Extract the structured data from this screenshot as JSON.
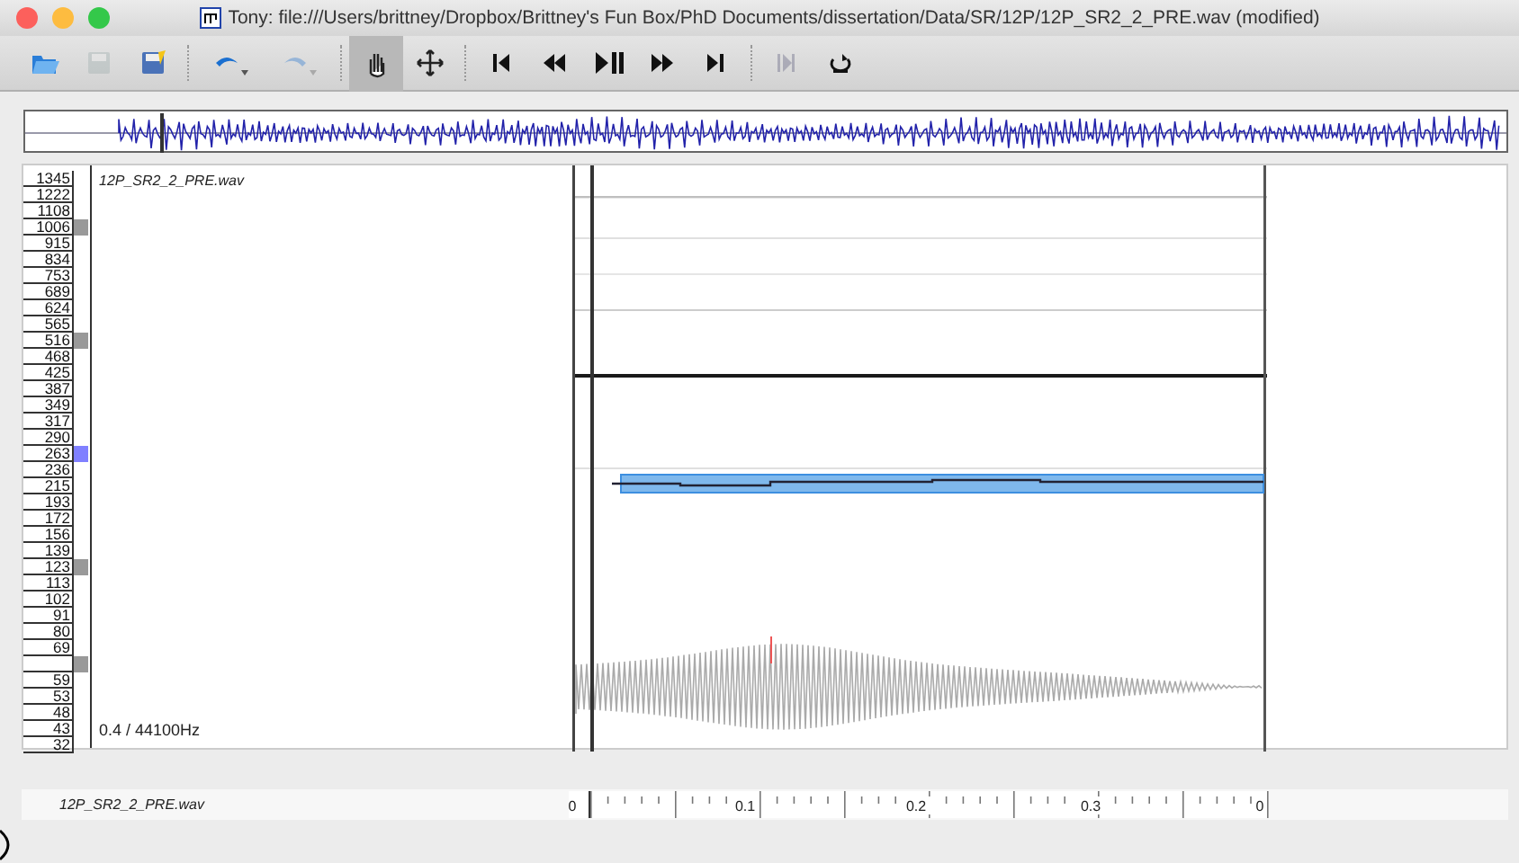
{
  "window": {
    "title": "Tony: file:///Users/brittney/Dropbox/Brittney's Fun Box/PhD Documents/dissertation/Data/SR/12P/12P_SR2_2_PRE.wav (modified)"
  },
  "toolbar": [
    {
      "selected": false,
      "disabled": false
    },
    {
      "selected": false,
      "disabled": true
    },
    {
      "selected": false,
      "disabled": false
    },
    {
      "selected": false,
      "disabled": false
    },
    {
      "selected": false,
      "disabled": true
    },
    {
      "selected": true,
      "disabled": false
    },
    {
      "selected": false,
      "disabled": false
    },
    {
      "selected": false,
      "disabled": false
    },
    {
      "selected": false,
      "disabled": false
    },
    {
      "selected": false,
      "disabled": false
    },
    {
      "selected": false,
      "disabled": false
    },
    {
      "selected": false,
      "disabled": false
    },
    {
      "selected": false,
      "disabled": true
    },
    {
      "selected": false,
      "disabled": false
    }
  ],
  "pane": {
    "file_label": "12P_SR2_2_PRE.wav",
    "info": "0.4 / 44100Hz",
    "scale": [
      {
        "label": "1345"
      },
      {
        "label": "1222"
      },
      {
        "label": "1108"
      },
      {
        "label": "1006",
        "color": "#999999"
      },
      {
        "label": "915"
      },
      {
        "label": "834"
      },
      {
        "label": "753"
      },
      {
        "label": "689"
      },
      {
        "label": "624"
      },
      {
        "label": "565"
      },
      {
        "label": "516",
        "color": "#999999"
      },
      {
        "label": "468"
      },
      {
        "label": "425"
      },
      {
        "label": "387"
      },
      {
        "label": "349"
      },
      {
        "label": "317"
      },
      {
        "label": "290"
      },
      {
        "label": "263",
        "color": "#8080ff"
      },
      {
        "label": "236"
      },
      {
        "label": "215"
      },
      {
        "label": "193"
      },
      {
        "label": "172"
      },
      {
        "label": "156"
      },
      {
        "label": "139"
      },
      {
        "label": "123",
        "color": "#999999"
      },
      {
        "label": "113"
      },
      {
        "label": "102"
      },
      {
        "label": "91"
      },
      {
        "label": "80"
      },
      {
        "label": "69"
      },
      {
        "color": "#999999"
      },
      {
        "label": "59"
      },
      {
        "label": "53"
      },
      {
        "label": "48"
      },
      {
        "label": "43"
      },
      {
        "label": "32"
      }
    ]
  },
  "timeline": {
    "file_label": "12P_SR2_2_PRE.wav",
    "ticks": [
      "0",
      "0.1",
      "0.2",
      "0.3",
      "0"
    ]
  }
}
